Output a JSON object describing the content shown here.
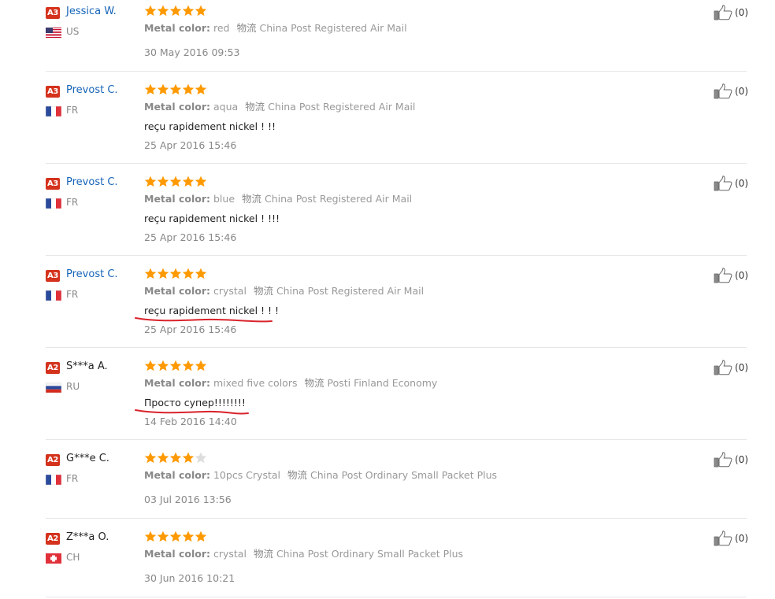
{
  "colors": {
    "link": "#1664b8",
    "badge": "#d4321c",
    "star": "#ff9900",
    "star_empty": "#dddddd",
    "underline": "#d9232b"
  },
  "icons": {
    "like": "thumbs-up-icon",
    "star": "star-icon"
  },
  "reviews": [
    {
      "badge": "A3",
      "name": "Jessica W.",
      "country": "US",
      "rating": 5,
      "metal_label": "Metal color:",
      "metal_value": "red",
      "logistics_label": "物流",
      "logistics_value": "China Post Registered Air Mail",
      "text": "",
      "date": "30 May 2016 09:53",
      "likes": "(0)"
    },
    {
      "badge": "A3",
      "name": "Prevost C.",
      "country": "FR",
      "rating": 5,
      "metal_label": "Metal color:",
      "metal_value": "aqua",
      "logistics_label": "物流",
      "logistics_value": "China Post Registered Air Mail",
      "text": "reçu rapidement nickel ! !!",
      "date": "25 Apr 2016 15:46",
      "likes": "(0)"
    },
    {
      "badge": "A3",
      "name": "Prevost C.",
      "country": "FR",
      "rating": 5,
      "metal_label": "Metal color:",
      "metal_value": "blue",
      "logistics_label": "物流",
      "logistics_value": "China Post Registered Air Mail",
      "text": "reçu rapidement nickel ! !!!",
      "date": "25 Apr 2016 15:46",
      "likes": "(0)"
    },
    {
      "badge": "A3",
      "name": "Prevost C.",
      "country": "FR",
      "rating": 5,
      "metal_label": "Metal color:",
      "metal_value": "crystal",
      "logistics_label": "物流",
      "logistics_value": "China Post Registered Air Mail",
      "text": "reçu rapidement nickel ! ! !",
      "date": "25 Apr 2016 15:46",
      "likes": "(0)"
    },
    {
      "badge": "A2",
      "name": "S***a A.",
      "country": "RU",
      "rating": 5,
      "metal_label": "Metal color:",
      "metal_value": "mixed five colors",
      "logistics_label": "物流",
      "logistics_value": "Posti Finland Economy",
      "text": "Просто супер!!!!!!!!",
      "date": "14 Feb 2016 14:40",
      "likes": "(0)"
    },
    {
      "badge": "A2",
      "name": "G***e C.",
      "country": "FR",
      "rating": 4,
      "metal_label": "Metal color:",
      "metal_value": "10pcs Crystal",
      "logistics_label": "物流",
      "logistics_value": "China Post Ordinary Small Packet Plus",
      "text": "",
      "date": "03 Jul 2016 13:56",
      "likes": "(0)"
    },
    {
      "badge": "A2",
      "name": "Z***a O.",
      "country": "CH",
      "rating": 5,
      "metal_label": "Metal color:",
      "metal_value": "crystal",
      "logistics_label": "物流",
      "logistics_value": "China Post Ordinary Small Packet Plus",
      "text": "",
      "date": "30 Jun 2016 10:21",
      "likes": "(0)"
    }
  ]
}
